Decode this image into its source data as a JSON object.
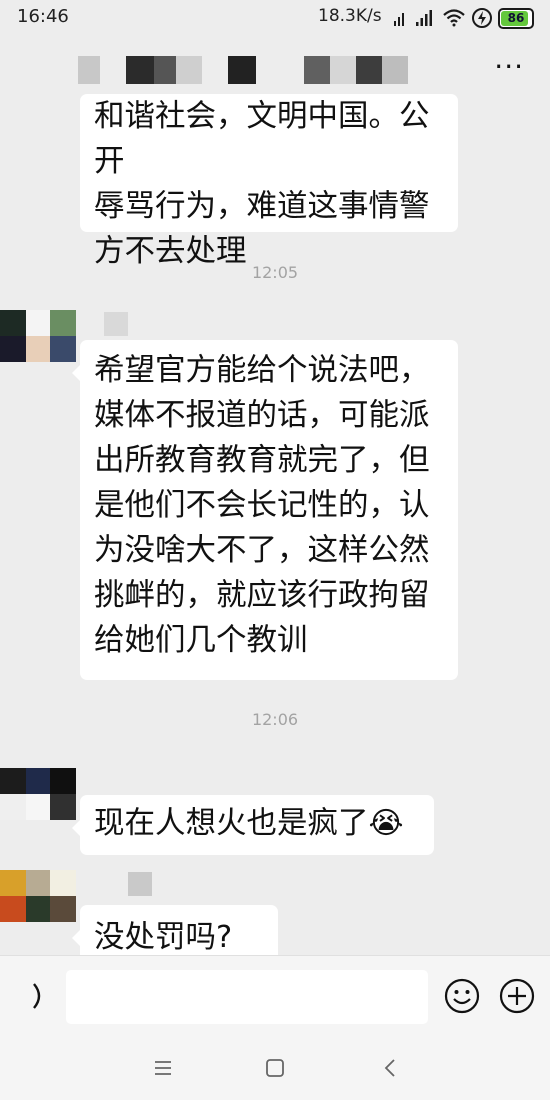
{
  "status_bar": {
    "time": "16:46",
    "network_speed": "18.3K/s",
    "battery": "86",
    "icons": [
      "signal-icon",
      "signal-icon",
      "wifi-icon",
      "charging-icon",
      "battery-icon"
    ]
  },
  "header": {
    "more_label": "···"
  },
  "messages": [
    {
      "lines": [
        "和谐社会，文明中国。公开",
        "辱骂行为，难道这事情警",
        "方不去处理"
      ]
    },
    {
      "timestamp": "12:05",
      "lines": [
        "希望官方能给个说法吧，",
        "媒体不报道的话，可能派",
        "出所教育教育就完了，但",
        "是他们不会长记性的，认",
        "为没啥大不了，这样公然",
        "挑衅的，就应该行政拘留",
        "给她们几个教训"
      ]
    },
    {
      "timestamp": "12:06",
      "lines": [
        "现在人想火也是疯了"
      ],
      "emoji": "😭"
    },
    {
      "lines": [
        "没处罚吗?"
      ]
    }
  ],
  "input_bar": {
    "placeholder": "",
    "voice_icon": "voice-icon",
    "emoji_icon": "emoji-icon",
    "add_icon": "add-icon"
  },
  "nav_bar": {
    "icons": [
      "menu-icon",
      "home-icon",
      "back-icon"
    ]
  },
  "colors": {
    "background": "#ededed",
    "bubble": "#ffffff",
    "timestamp": "#a3a3a3",
    "battery_fill": "#64c83c"
  }
}
